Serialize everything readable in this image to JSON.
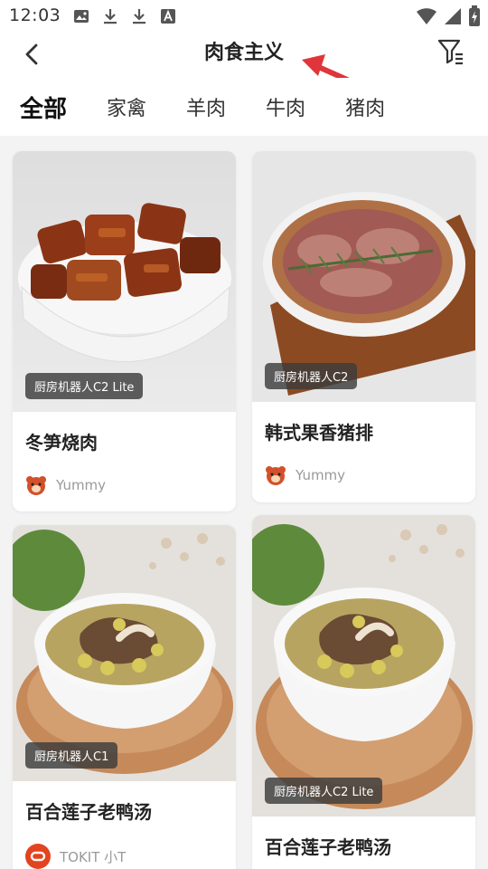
{
  "status": {
    "time": "12:03",
    "icons": [
      "image-icon",
      "download-icon",
      "download-icon",
      "text-a-icon"
    ],
    "right_icons": [
      "wifi-icon",
      "signal-icon",
      "battery-icon"
    ]
  },
  "header": {
    "title": "肉食主义",
    "back_icon": "chevron-left-icon",
    "filter_icon": "filter-icon",
    "annotation_color": "#e0353a"
  },
  "tabs": [
    {
      "label": "全部",
      "active": true
    },
    {
      "label": "家禽",
      "active": false
    },
    {
      "label": "羊肉",
      "active": false
    },
    {
      "label": "牛肉",
      "active": false
    },
    {
      "label": "猪肉",
      "active": false
    }
  ],
  "accent_color": "#f07a3a",
  "recipes": [
    {
      "title": "冬笋烧肉",
      "badge": "厨房机器人C2 Lite",
      "author": "Yummy",
      "author_icon": "bear-avatar-icon"
    },
    {
      "title": "韩式果香猪排",
      "badge": "厨房机器人C2",
      "author": "Yummy",
      "author_icon": "bear-avatar-icon"
    },
    {
      "title": "百合莲子老鸭汤",
      "badge": "厨房机器人C1",
      "author": "TOKIT 小T",
      "author_icon": "tokit-avatar-icon"
    },
    {
      "title": "百合莲子老鸭汤",
      "badge": "厨房机器人C2 Lite",
      "author": "",
      "author_icon": ""
    }
  ]
}
